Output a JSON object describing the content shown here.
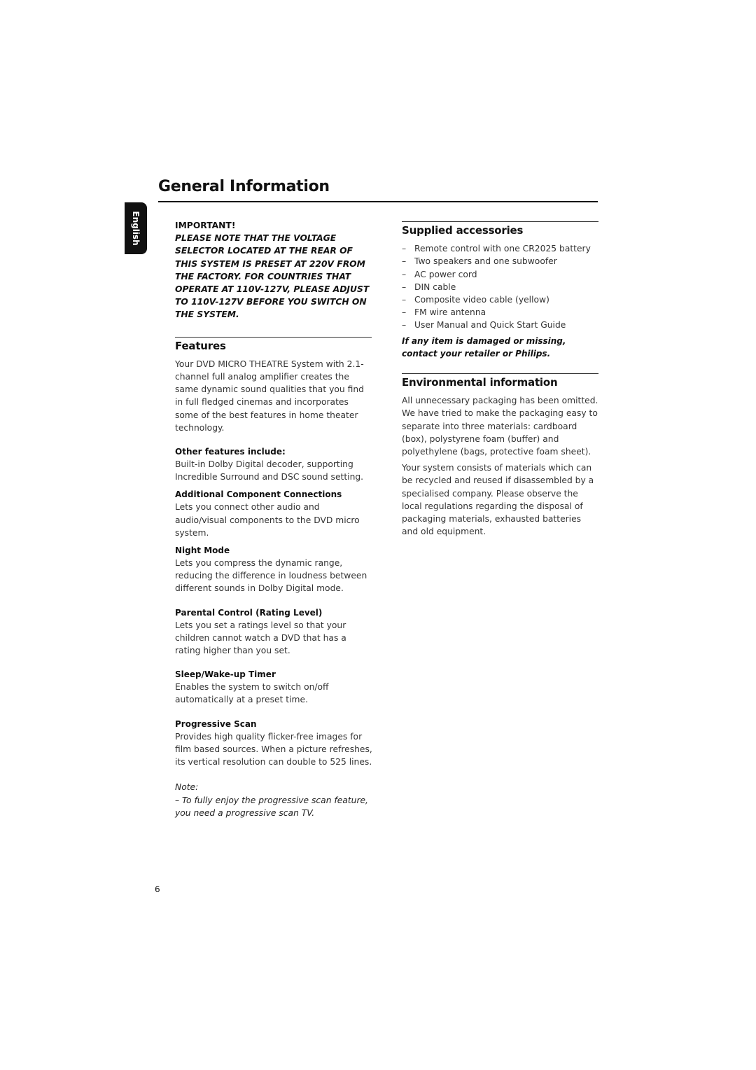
{
  "page": {
    "title": "General Information",
    "language_tab": "English",
    "page_number": "6"
  },
  "important": {
    "heading": "IMPORTANT!",
    "text": "PLEASE NOTE THAT THE VOLTAGE SELECTOR LOCATED AT THE REAR OF THIS SYSTEM IS PRESET AT 220V FROM THE FACTORY. FOR COUNTRIES THAT OPERATE AT 110V-127V, PLEASE ADJUST TO 110V-127V BEFORE YOU SWITCH ON THE SYSTEM."
  },
  "features": {
    "heading": "Features",
    "intro": "Your DVD MICRO THEATRE System  with 2.1-channel full analog amplifier creates the same dynamic sound qualities that you find in full fledged cinemas and incorporates some of the best features in home theater technology.",
    "items": [
      {
        "title": "Other features include:",
        "text": "Built-in Dolby Digital decoder, supporting Incredible Surround and DSC sound setting."
      },
      {
        "title": "Additional Component Connections",
        "text": "Lets you connect other audio and audio/visual components to the DVD micro system."
      },
      {
        "title": "Night Mode",
        "text": "Lets you compress the dynamic range, reducing the difference in loudness between different sounds in Dolby Digital mode."
      },
      {
        "title": "Parental Control (Rating Level)",
        "text": "Lets you set a ratings level so that your children cannot watch a DVD that has a rating higher than you set."
      },
      {
        "title": "Sleep/Wake-up Timer",
        "text": "Enables the system to switch on/off automatically at a preset time."
      },
      {
        "title": "Progressive Scan",
        "text": "Provides high quality flicker-free images for film based sources. When a picture refreshes, its vertical resolution can double to 525 lines."
      }
    ],
    "note_label": "Note:",
    "note_text": "–  To fully enjoy the progressive scan feature, you need a progressive scan TV."
  },
  "accessories": {
    "heading": "Supplied accessories",
    "dash": "–",
    "items": [
      "Remote control with one CR2025 battery",
      "Two speakers and one subwoofer",
      "AC power cord",
      "DIN cable",
      "Composite video cable (yellow)",
      "FM wire antenna",
      "User Manual and Quick Start Guide"
    ],
    "warning": "If any item is damaged or missing, contact your retailer or Philips."
  },
  "environment": {
    "heading": "Environmental information",
    "paragraphs": [
      "All unnecessary packaging has been omitted. We have tried to make the packaging easy to separate into three materials: cardboard (box), polystyrene foam (buffer) and polyethylene (bags, protective foam sheet).",
      "Your system consists of materials which can be recycled and reused if disassembled by a specialised company. Please observe the local regulations regarding the disposal of packaging materials, exhausted batteries and old equipment."
    ]
  }
}
